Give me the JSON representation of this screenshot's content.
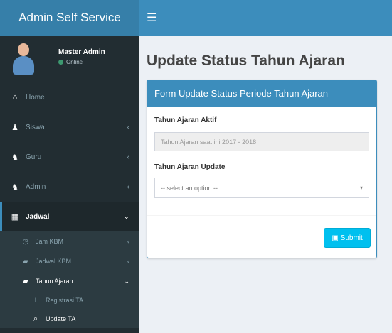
{
  "app": {
    "brand": "Admin Self Service",
    "toggle_icon": "☰"
  },
  "user": {
    "name": "Master Admin",
    "status": "Online",
    "status_color": "#3d9970"
  },
  "sidebar": {
    "items": [
      {
        "label": "Home",
        "icon": "home-icon",
        "glyph": "⌂"
      },
      {
        "label": "Siswa",
        "icon": "user-icon",
        "glyph": "♟"
      },
      {
        "label": "Guru",
        "icon": "users-icon",
        "glyph": "♞"
      },
      {
        "label": "Admin",
        "icon": "users-icon",
        "glyph": "♞"
      },
      {
        "label": "Jadwal",
        "icon": "calendar-icon",
        "glyph": "▦"
      }
    ],
    "jadwal_sub": [
      {
        "label": "Jam KBM",
        "icon": "clock-icon",
        "glyph": "◷"
      },
      {
        "label": "Jadwal KBM",
        "icon": "book-icon",
        "glyph": "▰"
      },
      {
        "label": "Tahun Ajaran",
        "icon": "book-icon",
        "glyph": "▰"
      }
    ],
    "tahun_sub": [
      {
        "label": "Registrasi TA",
        "icon": "plus-icon",
        "glyph": "+"
      },
      {
        "label": "Update TA",
        "icon": "search-icon",
        "glyph": "⌕"
      }
    ]
  },
  "page": {
    "title": "Update Status Tahun Ajaran"
  },
  "form": {
    "header": "Form Update Status Periode Tahun Ajaran",
    "field1_label": "Tahun Ajaran Aktif",
    "field1_value": "Tahun Ajaran saat ini 2017 - 2018",
    "field2_label": "Tahun Ajaran Update",
    "select_value": "-- select an option --",
    "submit_label": "Submit"
  },
  "colors": {
    "accent": "#3c8dbc",
    "brand_bg": "#367fa9",
    "sidebar_bg": "#222d32",
    "submit": "#00c0ef"
  }
}
